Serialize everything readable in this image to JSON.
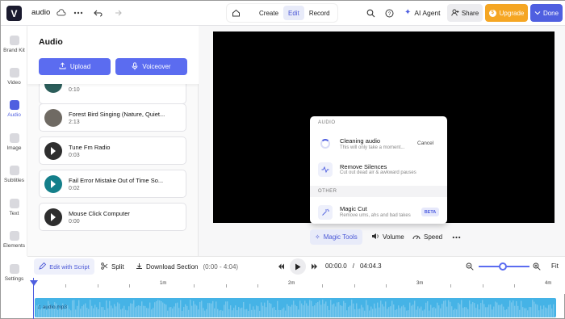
{
  "project": {
    "name": "audio"
  },
  "header": {
    "tabs": [
      {
        "label": "Create"
      },
      {
        "label": "Edit"
      },
      {
        "label": "Record"
      }
    ],
    "ai_agent": "AI Agent",
    "share": "Share",
    "upgrade": "Upgrade",
    "done": "Done"
  },
  "leftnav": [
    {
      "label": "Brand Kit",
      "icon": "brand-kit-icon"
    },
    {
      "label": "Video",
      "icon": "video-icon"
    },
    {
      "label": "Audio",
      "icon": "audio-icon",
      "active": true
    },
    {
      "label": "Image",
      "icon": "image-icon"
    },
    {
      "label": "Subtitles",
      "icon": "subtitles-icon"
    },
    {
      "label": "Text",
      "icon": "text-icon"
    },
    {
      "label": "Elements",
      "icon": "elements-icon"
    },
    {
      "label": "Settings",
      "icon": "settings-icon"
    }
  ],
  "panel": {
    "title": "Audio",
    "upload": "Upload",
    "voiceover": "Voiceover",
    "tracks": [
      {
        "title": "",
        "duration": "0:10"
      },
      {
        "title": "Forest Bird Singing (Nature, Quiet...",
        "duration": "2:13"
      },
      {
        "title": "Tune Fm Radio",
        "duration": "0:03"
      },
      {
        "title": "Fail Error Mistake Out of Time So...",
        "duration": "0:02"
      },
      {
        "title": "Mouse Click Computer",
        "duration": "0:00"
      }
    ]
  },
  "popup": {
    "section_audio": "AUDIO",
    "cleaning_title": "Cleaning audio",
    "cleaning_sub": "This will only take a moment...",
    "cancel": "Cancel",
    "remove_title": "Remove Silences",
    "remove_sub": "Cut out dead air & awkward pauses",
    "section_other": "OTHER",
    "magic_title": "Magic Cut",
    "magic_sub": "Remove ums, ahs and bad takes",
    "beta": "BETA"
  },
  "preview_toolbar": {
    "magic_tools": "Magic Tools",
    "volume": "Volume",
    "speed": "Speed"
  },
  "timeline": {
    "edit_with_script": "Edit with Script",
    "split": "Split",
    "download_section": "Download Section",
    "section_range": "(0:00 - 4:04)",
    "current_time": "00:00.0",
    "separator": "/",
    "total_time": "04:04.3",
    "fit": "Fit",
    "ruler": [
      "1m",
      "2m",
      "3m",
      "4m"
    ],
    "clip_name": "audio.mp3"
  },
  "colors": {
    "accent": "#4f5fe0",
    "upgrade": "#f5a623",
    "clip": "#45b3e6"
  }
}
